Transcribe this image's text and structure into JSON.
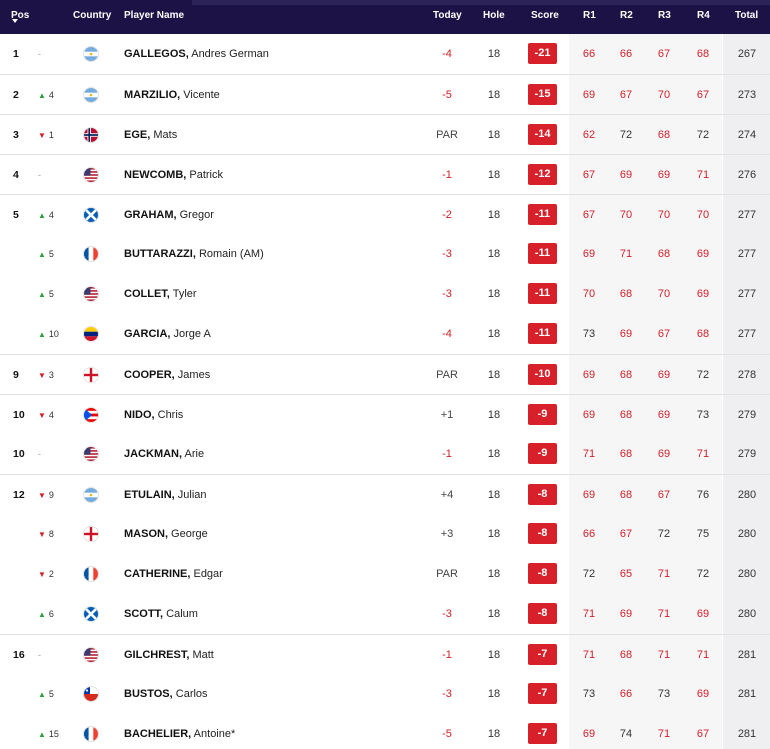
{
  "header": {
    "pos": "Pos",
    "country": "Country",
    "player": "Player Name",
    "today": "Today",
    "hole": "Hole",
    "score": "Score",
    "r1": "R1",
    "r2": "R2",
    "r3": "R3",
    "r4": "R4",
    "total": "Total"
  },
  "colors": {
    "header_bg": "#1c1246",
    "score_bg": "#d8202a",
    "under_par_text": "#d0202a",
    "move_up": "#2a9d3c",
    "move_down": "#d0202a",
    "shaded_column_bg": "#f6f6f7"
  },
  "rows": [
    {
      "pos": "1",
      "dir": "same",
      "move": "-",
      "country": "arg",
      "last": "GALLEGOS,",
      "first": "Andres German",
      "today": "-4",
      "hole": "18",
      "score": "-21",
      "r1": "66",
      "r2": "66",
      "r3": "67",
      "r4": "68",
      "total": "267",
      "sep": false
    },
    {
      "pos": "2",
      "dir": "up",
      "move": "4",
      "country": "arg",
      "last": "MARZILIO,",
      "first": "Vicente",
      "today": "-5",
      "hole": "18",
      "score": "-15",
      "r1": "69",
      "r2": "67",
      "r3": "70",
      "r4": "67",
      "total": "273",
      "sep": true
    },
    {
      "pos": "3",
      "dir": "down",
      "move": "1",
      "country": "nor",
      "last": "EGE,",
      "first": "Mats",
      "today": "PAR",
      "hole": "18",
      "score": "-14",
      "r1": "62",
      "r2": "72",
      "r3": "68",
      "r4": "72",
      "total": "274",
      "sep": true
    },
    {
      "pos": "4",
      "dir": "same",
      "move": "-",
      "country": "usa",
      "last": "NEWCOMB,",
      "first": "Patrick",
      "today": "-1",
      "hole": "18",
      "score": "-12",
      "r1": "67",
      "r2": "69",
      "r3": "69",
      "r4": "71",
      "total": "276",
      "sep": true
    },
    {
      "pos": "5",
      "dir": "up",
      "move": "4",
      "country": "sco",
      "last": "GRAHAM,",
      "first": "Gregor",
      "today": "-2",
      "hole": "18",
      "score": "-11",
      "r1": "67",
      "r2": "70",
      "r3": "70",
      "r4": "70",
      "total": "277",
      "sep": true
    },
    {
      "pos": "",
      "dir": "up",
      "move": "5",
      "country": "fra",
      "last": "BUTTARAZZI,",
      "first": "Romain (AM)",
      "today": "-3",
      "hole": "18",
      "score": "-11",
      "r1": "69",
      "r2": "71",
      "r3": "68",
      "r4": "69",
      "total": "277",
      "sep": false
    },
    {
      "pos": "",
      "dir": "up",
      "move": "5",
      "country": "usa",
      "last": "COLLET,",
      "first": "Tyler",
      "today": "-3",
      "hole": "18",
      "score": "-11",
      "r1": "70",
      "r2": "68",
      "r3": "70",
      "r4": "69",
      "total": "277",
      "sep": false
    },
    {
      "pos": "",
      "dir": "up",
      "move": "10",
      "country": "ven",
      "last": "GARCIA,",
      "first": "Jorge A",
      "today": "-4",
      "hole": "18",
      "score": "-11",
      "r1": "73",
      "r2": "69",
      "r3": "67",
      "r4": "68",
      "total": "277",
      "sep": false
    },
    {
      "pos": "9",
      "dir": "down",
      "move": "3",
      "country": "eng",
      "last": "COOPER,",
      "first": "James",
      "today": "PAR",
      "hole": "18",
      "score": "-10",
      "r1": "69",
      "r2": "68",
      "r3": "69",
      "r4": "72",
      "total": "278",
      "sep": true
    },
    {
      "pos": "10",
      "dir": "down",
      "move": "4",
      "country": "pur",
      "last": "NIDO,",
      "first": "Chris",
      "today": "+1",
      "hole": "18",
      "score": "-9",
      "r1": "69",
      "r2": "68",
      "r3": "69",
      "r4": "73",
      "total": "279",
      "sep": true
    },
    {
      "pos": "10",
      "dir": "same",
      "move": "-",
      "country": "usa",
      "last": "JACKMAN,",
      "first": "Arie",
      "today": "-1",
      "hole": "18",
      "score": "-9",
      "r1": "71",
      "r2": "68",
      "r3": "69",
      "r4": "71",
      "total": "279",
      "sep": false
    },
    {
      "pos": "12",
      "dir": "down",
      "move": "9",
      "country": "arg",
      "last": "ETULAIN,",
      "first": "Julian",
      "today": "+4",
      "hole": "18",
      "score": "-8",
      "r1": "69",
      "r2": "68",
      "r3": "67",
      "r4": "76",
      "total": "280",
      "sep": true
    },
    {
      "pos": "",
      "dir": "down",
      "move": "8",
      "country": "eng",
      "last": "MASON,",
      "first": "George",
      "today": "+3",
      "hole": "18",
      "score": "-8",
      "r1": "66",
      "r2": "67",
      "r3": "72",
      "r4": "75",
      "total": "280",
      "sep": false
    },
    {
      "pos": "",
      "dir": "down",
      "move": "2",
      "country": "fra",
      "last": "CATHERINE,",
      "first": "Edgar",
      "today": "PAR",
      "hole": "18",
      "score": "-8",
      "r1": "72",
      "r2": "65",
      "r3": "71",
      "r4": "72",
      "total": "280",
      "sep": false
    },
    {
      "pos": "",
      "dir": "up",
      "move": "6",
      "country": "sco",
      "last": "SCOTT,",
      "first": "Calum",
      "today": "-3",
      "hole": "18",
      "score": "-8",
      "r1": "71",
      "r2": "69",
      "r3": "71",
      "r4": "69",
      "total": "280",
      "sep": false
    },
    {
      "pos": "16",
      "dir": "same",
      "move": "-",
      "country": "usa",
      "last": "GILCHREST,",
      "first": "Matt",
      "today": "-1",
      "hole": "18",
      "score": "-7",
      "r1": "71",
      "r2": "68",
      "r3": "71",
      "r4": "71",
      "total": "281",
      "sep": true
    },
    {
      "pos": "",
      "dir": "up",
      "move": "5",
      "country": "chi",
      "last": "BUSTOS,",
      "first": "Carlos",
      "today": "-3",
      "hole": "18",
      "score": "-7",
      "r1": "73",
      "r2": "66",
      "r3": "73",
      "r4": "69",
      "total": "281",
      "sep": false
    },
    {
      "pos": "",
      "dir": "up",
      "move": "15",
      "country": "fra",
      "last": "BACHELIER,",
      "first": "Antoine*",
      "today": "-5",
      "hole": "18",
      "score": "-7",
      "r1": "69",
      "r2": "74",
      "r3": "71",
      "r4": "67",
      "total": "281",
      "sep": false
    }
  ]
}
